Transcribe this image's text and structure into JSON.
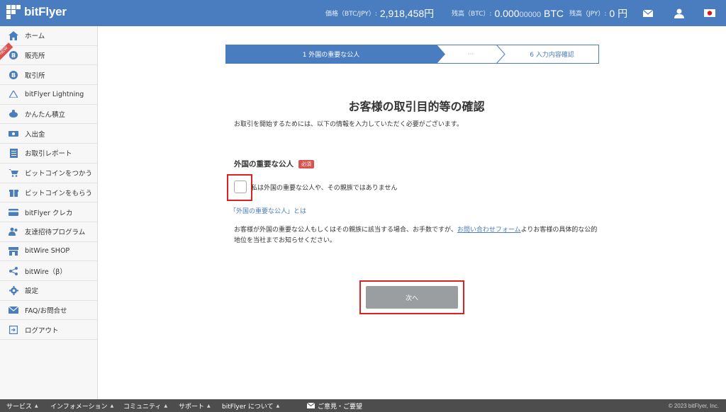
{
  "header": {
    "brand": "bitFlyer",
    "price_label": "価格（BTC/JPY）:",
    "price_value": "2,918,458円",
    "btc_label": "残高（BTC）:",
    "btc_main": "0.000",
    "btc_dim": "00000",
    "btc_unit": " BTC",
    "jpy_label": "残高（JPY）:",
    "jpy_value": "0 円",
    "icons": [
      "mail-icon",
      "user-icon",
      "japan-flag-icon"
    ]
  },
  "sidebar": {
    "new_badge": "NEW",
    "items": [
      {
        "label": "ホーム",
        "icon": "home-icon"
      },
      {
        "label": "販売所",
        "icon": "bitcoin-icon"
      },
      {
        "label": "取引所",
        "icon": "bitcoin-icon"
      },
      {
        "label": "bitFlyer Lightning",
        "icon": "lightning-icon"
      },
      {
        "label": "かんたん積立",
        "icon": "piggy-icon"
      },
      {
        "label": "入出金",
        "icon": "cash-icon"
      },
      {
        "label": "お取引レポート",
        "icon": "report-icon"
      },
      {
        "label": "ビットコインをつかう",
        "icon": "cart-icon"
      },
      {
        "label": "ビットコインをもらう",
        "icon": "gift-icon"
      },
      {
        "label": "bitFlyer クレカ",
        "icon": "card-icon"
      },
      {
        "label": "友達招待プログラム",
        "icon": "friends-icon"
      },
      {
        "label": "bitWire SHOP",
        "icon": "shop-icon"
      },
      {
        "label": "bitWire（β）",
        "icon": "share-icon"
      },
      {
        "label": "設定",
        "icon": "gear-icon"
      },
      {
        "label": "FAQ/お問合せ",
        "icon": "envelope-icon"
      },
      {
        "label": "ログアウト",
        "icon": "logout-icon"
      }
    ]
  },
  "stepper": {
    "step1": "1  外国の重要な公人",
    "ellipsis": "···",
    "step6": "6  入力内容確認",
    "active_color": "#4a7dbf"
  },
  "main": {
    "title": "お客様の取引目的等の確認",
    "intro": "お取引を開始するためには、以下の情報を入力していただく必要がございます。",
    "section_title": "外国の重要な公人",
    "required_badge": "必須",
    "checkbox_label": "私は外国の重要な公人や、その親族ではありません",
    "pep_link": "「外国の重要な公人」とは",
    "notice_before": "お客様が外国の重要な公人もしくはその親族に該当する場合、お手数ですが、",
    "notice_link": "お問い合わせフォーム",
    "notice_after": "よりお客様の具体的な公的地位を当社までお知らせください。",
    "next_button": "次へ"
  },
  "footer": {
    "items": [
      "サービス",
      "インフォメーション",
      "コミュニティ",
      "サポート",
      "bitFlyer について"
    ],
    "feedback": "ご意見・ご要望",
    "copyright": "© 2023 bitFlyer, Inc."
  },
  "colors": {
    "header_bg": "#4a7dbf",
    "highlight": "#e02020",
    "button_disabled": "#9b9ea1"
  }
}
